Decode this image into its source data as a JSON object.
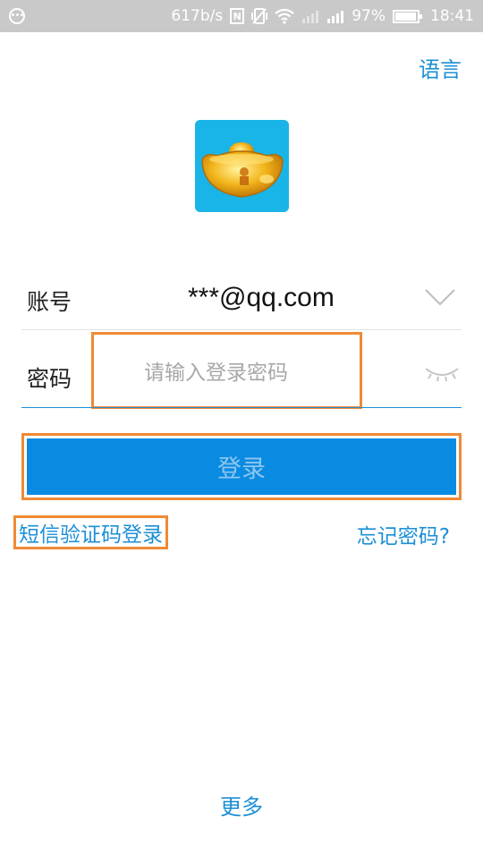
{
  "status_bar": {
    "network_speed": "617b/s",
    "battery_percent": "97%",
    "time": "18:41",
    "icons": [
      "more-icon",
      "nfc-icon",
      "vibrate-icon",
      "wifi-icon",
      "signal-icon",
      "signal-icon",
      "battery-icon"
    ],
    "battery_level": 0.97
  },
  "header": {
    "language_label": "语言"
  },
  "app": {
    "icon_name": "gold-ingot-icon"
  },
  "form": {
    "account_label": "账号",
    "account_value": "***@qq.com",
    "password_label": "密码",
    "password_placeholder": "请输入登录密码"
  },
  "actions": {
    "login_label": "登录",
    "sms_login_label": "短信验证码登录",
    "forgot_password_label": "忘记密码?",
    "more_label": "更多"
  },
  "colors": {
    "accent": "#1c8fd6",
    "button": "#0a8be2",
    "highlight_border": "#f08a35",
    "status_bar": "#c9c9c9"
  }
}
